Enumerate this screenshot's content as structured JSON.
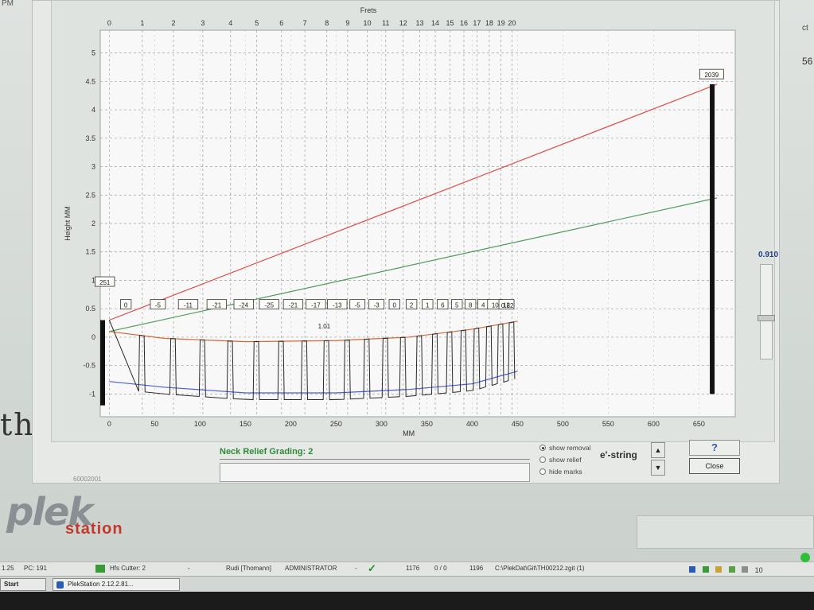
{
  "desktop": {
    "corner_time": "PM",
    "background_text": "th r",
    "right_clip_top": "ct",
    "right_clip_mid": "56"
  },
  "chart": {
    "top_axis_title": "Frets",
    "x_axis_title": "MM",
    "y_axis_title": "Height MM",
    "top_ticks": [
      "0",
      "1",
      "2",
      "3",
      "4",
      "5",
      "6",
      "7",
      "8",
      "9",
      "10",
      "11",
      "12",
      "13",
      "14",
      "15",
      "16",
      "17",
      "18",
      "19",
      "20"
    ],
    "x_ticks": [
      "0",
      "50",
      "100",
      "150",
      "200",
      "250",
      "300",
      "350",
      "400",
      "450",
      "500",
      "550",
      "600",
      "650"
    ],
    "y_ticks": [
      "-1",
      "-0.5",
      "0",
      "0.5",
      "1",
      "1.5",
      "2",
      "2.5",
      "3",
      "3.5",
      "4",
      "4.5",
      "5"
    ],
    "nut_label": "251",
    "bridge_label": "2039",
    "fret_labels": [
      "0",
      "-5",
      "-11",
      "-21",
      "-24",
      "-25",
      "-21",
      "-17",
      "-13",
      "-5",
      "-3",
      "0",
      "2",
      "1",
      "6",
      "5",
      "8",
      "4",
      "10",
      "12"
    ],
    "annotation_mid": "1.01",
    "annotation_end": "0.82"
  },
  "chart_data": {
    "type": "line",
    "title": "",
    "xlabel": "MM",
    "ylabel": "Height MM",
    "top_axis_label": "Frets",
    "xlim": [
      -10,
      690
    ],
    "ylim": [
      -1.4,
      5.4
    ],
    "grid": true,
    "series": [
      {
        "color": "#e04a4a",
        "x": [
          0,
          670
        ],
        "y": [
          0.3,
          4.45
        ]
      },
      {
        "color": "#4f9a5a",
        "x": [
          0,
          670
        ],
        "y": [
          0.1,
          2.45
        ]
      },
      {
        "color": "#d26a3a",
        "x": [
          0,
          60,
          150,
          250,
          330,
          400,
          450
        ],
        "y": [
          0.1,
          -0.02,
          -0.08,
          -0.06,
          0.0,
          0.14,
          0.28
        ]
      },
      {
        "color": "#4a5fd0",
        "x": [
          0,
          60,
          150,
          250,
          330,
          400,
          450
        ],
        "y": [
          -0.78,
          -0.88,
          -0.98,
          -0.98,
          -0.92,
          -0.82,
          -0.6
        ]
      }
    ],
    "fret_labels": [
      "0",
      "-5",
      "-11",
      "-21",
      "-24",
      "-25",
      "-21",
      "-17",
      "-13",
      "-5",
      "-3",
      "0",
      "2",
      "1",
      "6",
      "5",
      "8",
      "4",
      "10",
      "12"
    ],
    "nut_value_label": "251",
    "bridge_value_label": "2039",
    "annotations": [
      "1.01",
      "0.82"
    ]
  },
  "slider": {
    "value": "0.910"
  },
  "controls": {
    "grading_label": "Neck Relief Grading: 2",
    "serial": "60002001",
    "radio_show_removal": "show removal",
    "radio_show_relief": "show relief",
    "radio_hide_marks": "hide marks",
    "string_label": "e'-string",
    "up_arrow": "▲",
    "down_arrow": "▼",
    "help_label": "?",
    "close_label": "Close"
  },
  "logo": {
    "plek": "plek",
    "station": "station"
  },
  "statusbar": {
    "v1": "1.25",
    "pc": "PC: 191",
    "cutter": "Hfs Cutter: 2",
    "dash": "-",
    "user": "Rudi [Thomann]",
    "role": "ADMINISTRATOR",
    "dash2": "-",
    "n1": "1176",
    "n2": "0 / 0",
    "n3": "1196",
    "path": "C:\\PlekDat\\Git\\TH00212.zgit (1)"
  },
  "taskbar": {
    "start": "Start",
    "app": "PlekStation 2.12.2.81...",
    "tray_text": "10"
  }
}
